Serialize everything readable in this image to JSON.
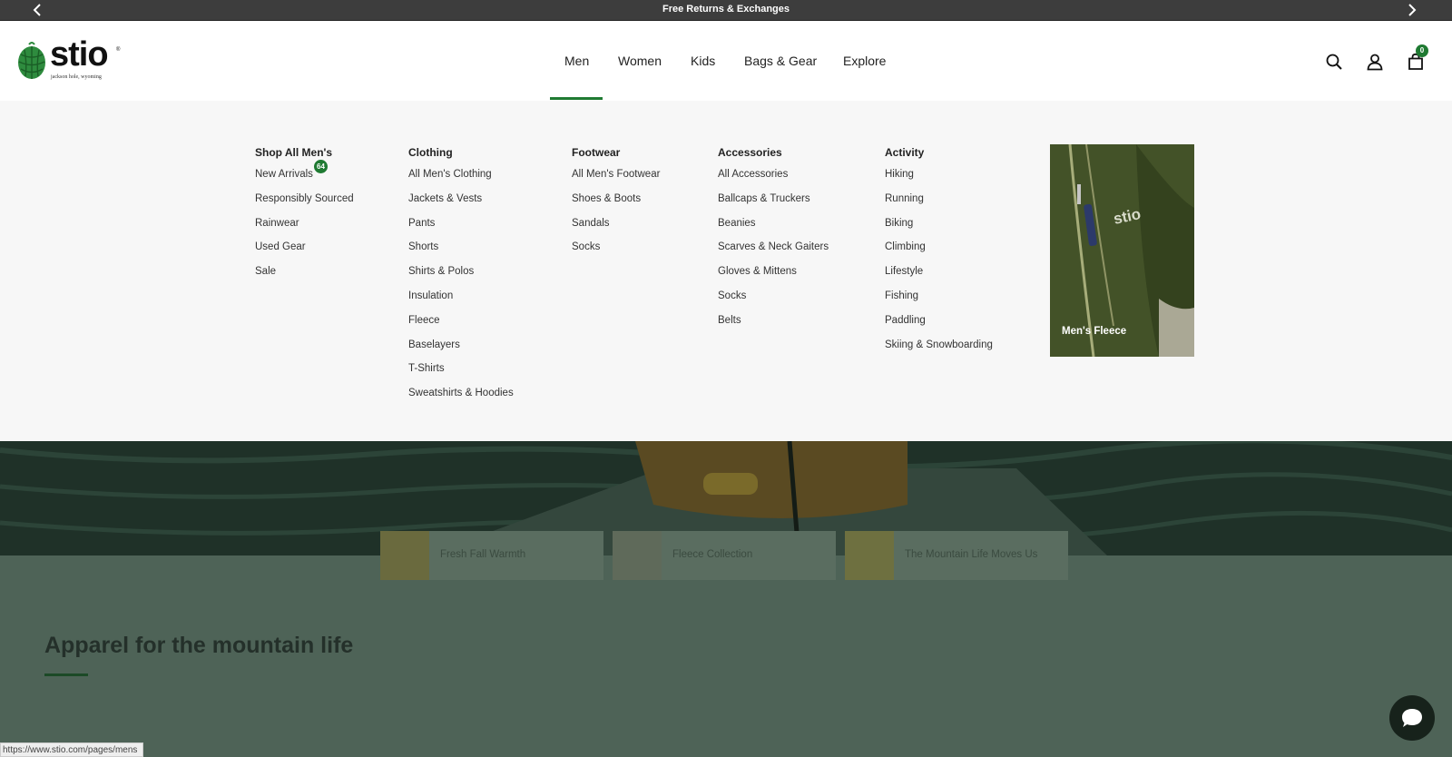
{
  "announcement": {
    "message": "Free Returns & Exchanges"
  },
  "brand": {
    "name": "stio",
    "tagline": "jackson hole, wyoming",
    "reg": "®"
  },
  "nav": {
    "items": [
      {
        "label": "Men"
      },
      {
        "label": "Women"
      },
      {
        "label": "Kids"
      },
      {
        "label": "Bags & Gear"
      },
      {
        "label": "Explore"
      }
    ],
    "active": "Men"
  },
  "header_icons": {
    "cart_count": "0"
  },
  "mega_menu": {
    "columns": [
      {
        "title": "Shop All Men's",
        "links": [
          "New Arrivals",
          "Responsibly Sourced",
          "Rainwear",
          "Used Gear",
          "Sale"
        ],
        "new_arrivals_badge": "64"
      },
      {
        "title": "Clothing",
        "links": [
          "All Men's Clothing",
          "Jackets & Vests",
          "Pants",
          "Shorts",
          "Shirts & Polos",
          "Insulation",
          "Fleece",
          "Baselayers",
          "T-Shirts",
          "Sweatshirts & Hoodies"
        ]
      },
      {
        "title": "Footwear",
        "links": [
          "All Men's Footwear",
          "Shoes & Boots",
          "Sandals",
          "Socks"
        ]
      },
      {
        "title": "Accessories",
        "links": [
          "All Accessories",
          "Ballcaps & Truckers",
          "Beanies",
          "Scarves & Neck Gaiters",
          "Gloves & Mittens",
          "Socks",
          "Belts"
        ]
      },
      {
        "title": "Activity",
        "links": [
          "Hiking",
          "Running",
          "Biking",
          "Climbing",
          "Lifestyle",
          "Fishing",
          "Paddling",
          "Skiing & Snowboarding"
        ]
      }
    ],
    "promo": {
      "label": "Men's Fleece",
      "logo_text": "stio"
    }
  },
  "hero_pills": [
    {
      "label": "Fresh Fall Warmth"
    },
    {
      "label": "Fleece Collection"
    },
    {
      "label": "The Mountain Life Moves Us"
    }
  ],
  "section": {
    "title": "Apparel for the mountain life"
  },
  "status_bar": {
    "url": "https://www.stio.com/pages/mens"
  },
  "colors": {
    "accent": "#1f7a32",
    "announce_bg": "#3d3d3d",
    "mega_bg": "#f7f7f7",
    "overlay": "#4e6357"
  }
}
